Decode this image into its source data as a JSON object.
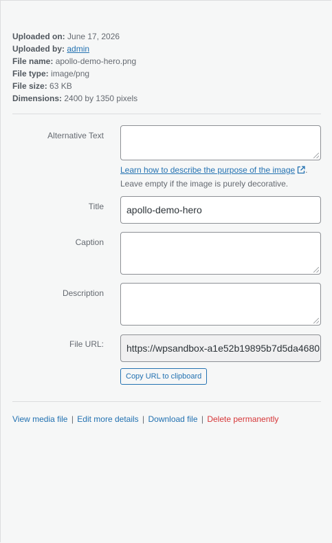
{
  "file_details": {
    "uploaded_on_label": "Uploaded on:",
    "uploaded_on": "June 17, 2026",
    "uploaded_by_label": "Uploaded by:",
    "uploaded_by": "admin",
    "file_name_label": "File name:",
    "file_name": "apollo-demo-hero.png",
    "file_type_label": "File type:",
    "file_type": "image/png",
    "file_size_label": "File size:",
    "file_size": "63 KB",
    "dimensions_label": "Dimensions:",
    "dimensions": "2400 by 1350 pixels"
  },
  "form": {
    "alt_text": {
      "label": "Alternative Text",
      "value": "",
      "help_link": "Learn how to describe the purpose of the image",
      "help_link_icon": "external-link-icon",
      "help_after": ".",
      "help_text": "Leave empty if the image is purely decorative."
    },
    "title": {
      "label": "Title",
      "value": "apollo-demo-hero"
    },
    "caption": {
      "label": "Caption",
      "value": ""
    },
    "description": {
      "label": "Description",
      "value": ""
    },
    "file_url": {
      "label": "File URL:",
      "value": "https://wpsandbox-a1e52b19895b7d5da4680",
      "copy_button": "Copy URL to clipboard"
    }
  },
  "actions": {
    "view": "View media file",
    "edit": "Edit more details",
    "download": "Download file",
    "delete": "Delete permanently",
    "separator": "|"
  },
  "colors": {
    "background": "#f6f7f7",
    "link": "#2271b1",
    "delete": "#d63638",
    "text": "#646970"
  }
}
